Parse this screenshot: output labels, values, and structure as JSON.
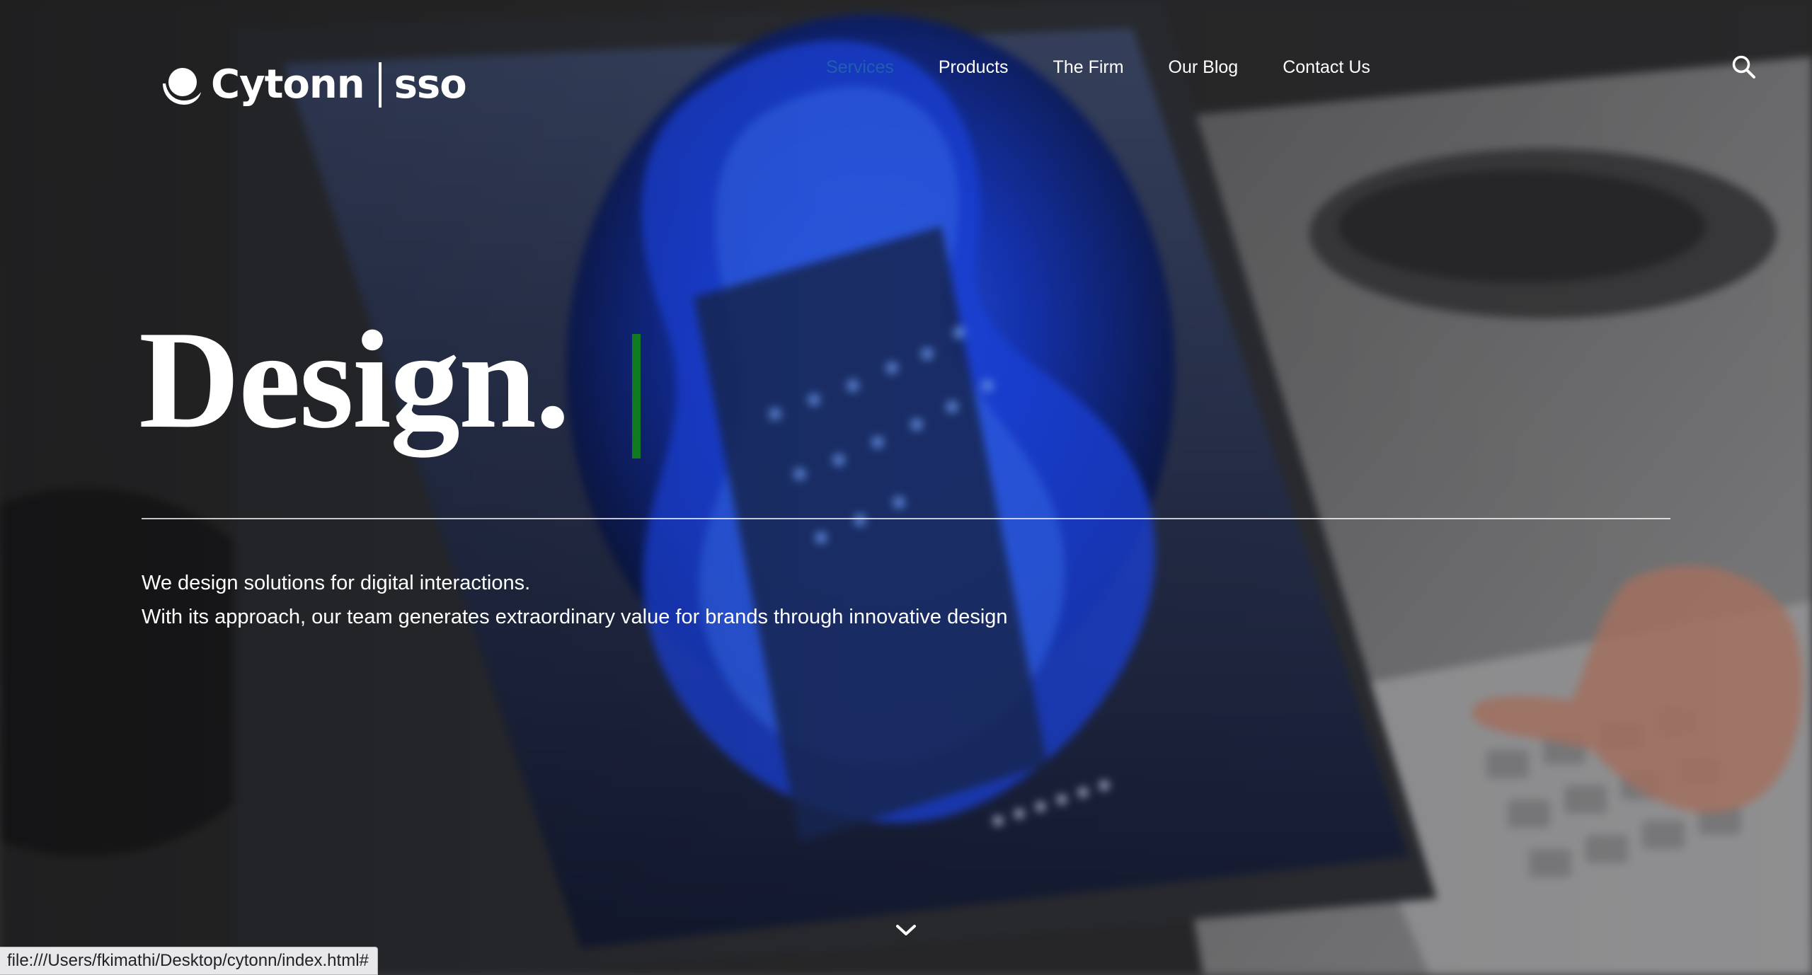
{
  "colors": {
    "accent_active_nav": "#1f5fae",
    "caret": "#0f7a1f",
    "text": "#ffffff",
    "scene_blue": "#1a4cff"
  },
  "header": {
    "logo": {
      "wordmark": "Cytonn",
      "suffix": "sso",
      "icon": "cytonn-logo-mark"
    },
    "nav": [
      {
        "label": "Services",
        "active": true
      },
      {
        "label": "Products",
        "active": false
      },
      {
        "label": "The Firm",
        "active": false
      },
      {
        "label": "Our Blog",
        "active": false
      },
      {
        "label": "Contact Us",
        "active": false
      }
    ],
    "search_icon": "search-icon"
  },
  "hero": {
    "title": "Design.",
    "line1": "We design solutions for digital interactions.",
    "line2": "With its approach, our team generates extraordinary value for brands through innovative design",
    "scroll_icon": "chevron-down-icon"
  },
  "status_bar": {
    "url": "file:///Users/fkimathi/Desktop/cytonn/index.html#"
  }
}
